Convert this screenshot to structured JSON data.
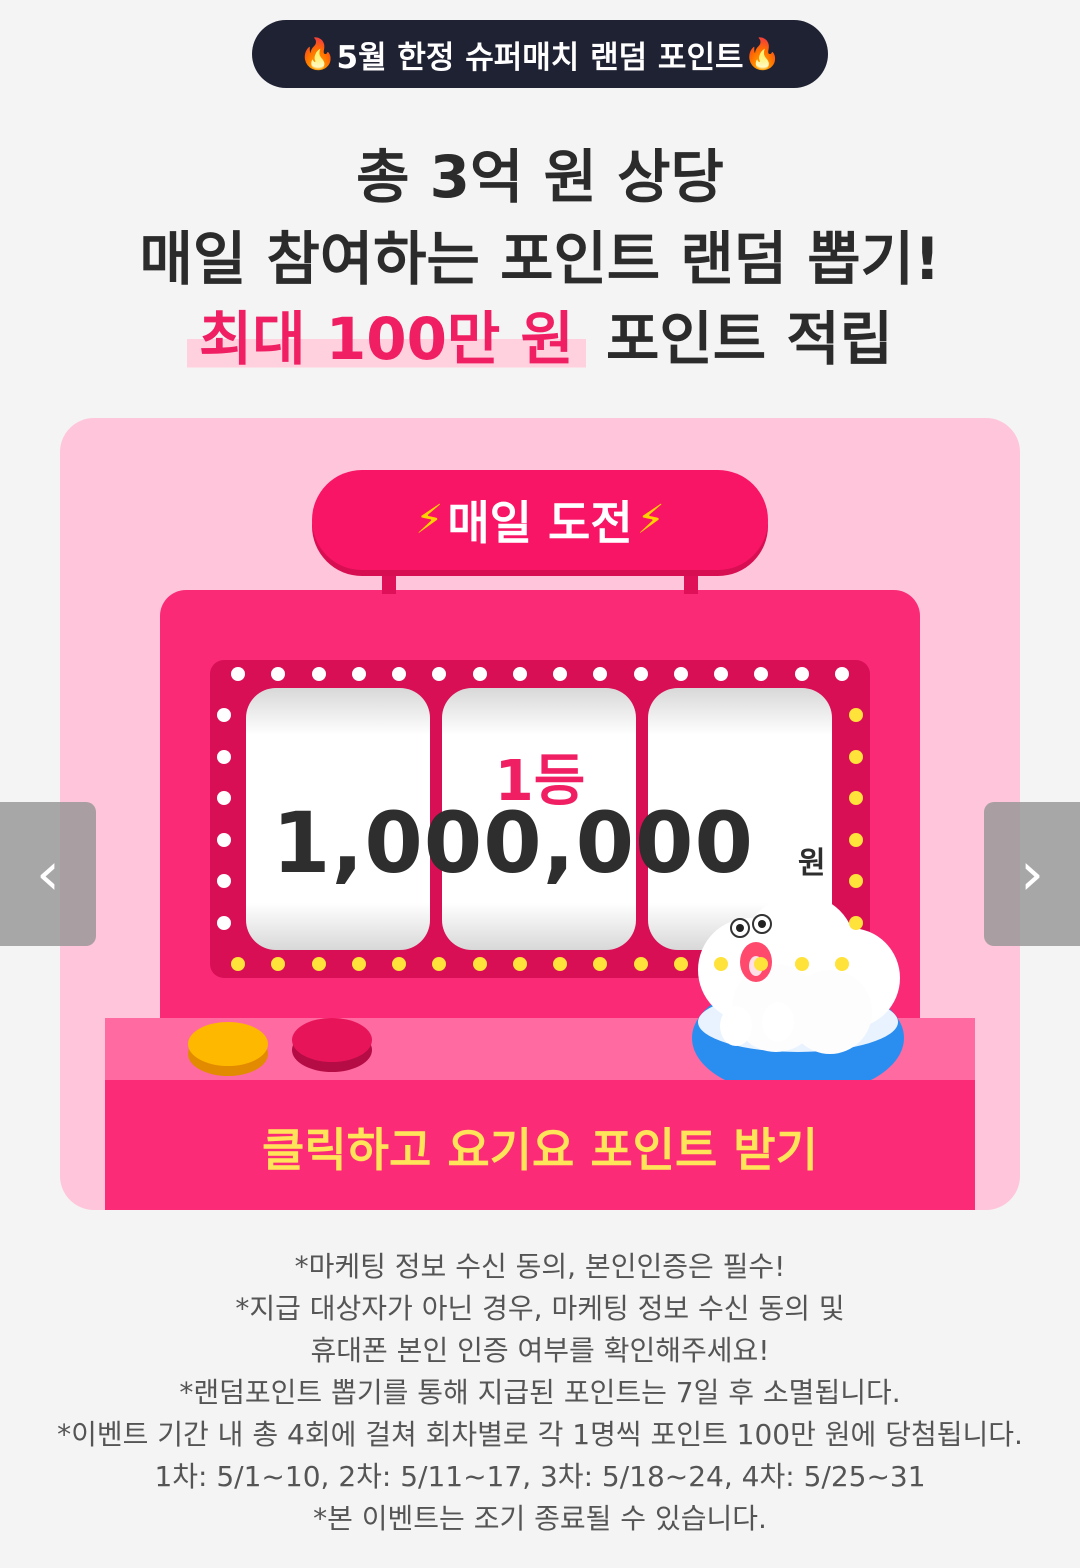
{
  "banner": {
    "label": "5월 한정 슈퍼매치 랜덤 포인트",
    "icon": "fire-icon"
  },
  "headline": {
    "line1": "총 3억 원 상당",
    "line2": "매일 참여하는 포인트 랜덤 뽑기!",
    "line3_highlight": "최대 100만 원",
    "line3_rest": "포인트 적립"
  },
  "slot_machine": {
    "sign_label": "매일 도전",
    "rank": "1등",
    "prize_amount": "1,000,000",
    "prize_unit": "원",
    "cta": "클릭하고 요기요 포인트 받기",
    "colors": {
      "card": "#ffc5da",
      "cabinet": "#fa2a76",
      "accent": "#f01e63",
      "cta_text": "#ffe45a"
    }
  },
  "carousel": {
    "prev_icon": "chevron-left-icon",
    "next_icon": "chevron-right-icon"
  },
  "notes": [
    "*마케팅 정보 수신 동의, 본인인증은 필수!",
    "*지급 대상자가 아닌 경우, 마케팅 정보 수신 동의 및",
    "휴대폰 본인 인증 여부를 확인해주세요!",
    "*랜덤포인트 뽑기를 통해 지급된 포인트는 7일 후 소멸됩니다.",
    "*이벤트 기간 내 총 4회에 걸쳐 회차별로 각 1명씩 포인트 100만 원에 당첨됩니다.",
    "1차: 5/1~10, 2차: 5/11~17, 3차: 5/18~24, 4차: 5/25~31",
    "*본 이벤트는 조기 종료될 수 있습니다."
  ]
}
